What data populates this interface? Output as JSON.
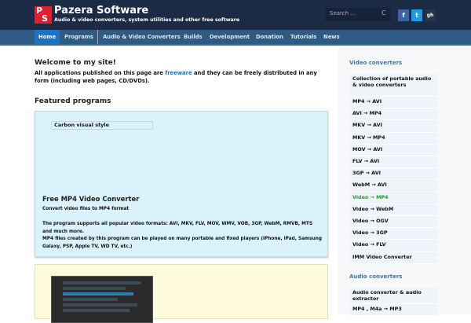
{
  "header": {
    "logo": [
      "P",
      "S"
    ],
    "title": "Pazera Software",
    "tagline": "Audio & video converters, system utilities and other free software",
    "search_placeholder": "Search ...",
    "search_icon": "C",
    "social": [
      "f",
      "t",
      "gh"
    ]
  },
  "nav": [
    "Home",
    "Programs",
    "Audio & Video Converters",
    "Builds",
    "Development",
    "Donation",
    "Tutorials",
    "News"
  ],
  "main": {
    "welcome": "Welcome to my site!",
    "intro_before": "All applications published on this page are ",
    "intro_link": "freeware",
    "intro_after": " and they can be freely distributed in any form (including web pages, CD/DVDs).",
    "featured": "Featured programs",
    "card": {
      "caption": "Carbon visual style",
      "title": "Free MP4 Video Converter",
      "subtitle": "Convert video files to MP4 format",
      "desc1": "The program supports all popular video formats: AVI, MKV, FLV, MOV, WMV, VOB, 3GP, WebM, RMVB, MTS and much more.",
      "desc2": "MP4 files created by this program can be played on many portable and fixed players (iPhone, iPad, Samsung Galaxy, PSP, Apple TV, WD TV, etc.)"
    }
  },
  "sidebar": {
    "video_heading": "Video converters",
    "video_items": [
      "Collection of portable audio & video converters",
      "MP4 → AVI",
      "AVI → MP4",
      "MKV → AVI",
      "MKV → MP4",
      "MOV → AVI",
      "FLV → AVI",
      "3GP → AVI",
      "WebM → AVI",
      "Video → MP4",
      "Video → WebM",
      "Video → OGV",
      "Video → 3GP",
      "Video → FLV",
      "IMM Video Converter"
    ],
    "active_item": "Video → MP4",
    "audio_heading": "Audio converters",
    "audio_items": [
      "Audio converter & audio extractor",
      "MP4 , M4a → MP3"
    ]
  }
}
